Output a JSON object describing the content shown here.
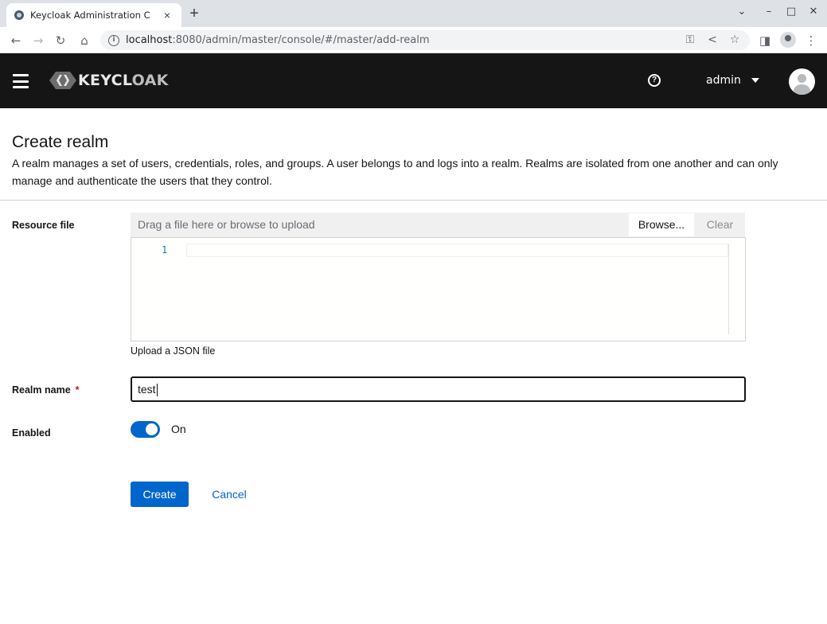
{
  "browser": {
    "tab_title": "Keycloak Administration C",
    "tab_close": "×",
    "new_tab": "+",
    "address_host": "localhost",
    "address_path": ":8080/admin/master/console/#/master/add-realm",
    "window_controls": [
      "⌄",
      "–",
      "□",
      "✕"
    ]
  },
  "header": {
    "brand_main": "KEYCL",
    "brand_end": "OAK",
    "help_glyph": "?",
    "user": "admin"
  },
  "page": {
    "title": "Create realm",
    "description": "A realm manages a set of users, credentials, roles, and groups. A user belongs to and logs into a realm. Realms are isolated from one another and can only manage and authenticate the users that they control."
  },
  "form": {
    "resource_file_label": "Resource file",
    "upload_placeholder": "Drag a file here or browse to upload",
    "browse_label": "Browse...",
    "clear_label": "Clear",
    "editor_line_number": "1",
    "helper_text": "Upload a JSON file",
    "realm_name_label": "Realm name",
    "required_mark": "*",
    "realm_name_value": "test",
    "enabled_label": "Enabled",
    "enabled_state": "On",
    "create_label": "Create",
    "cancel_label": "Cancel"
  },
  "colors": {
    "primary": "#0066cc",
    "header_bg": "#151515",
    "required": "#c9190b"
  }
}
